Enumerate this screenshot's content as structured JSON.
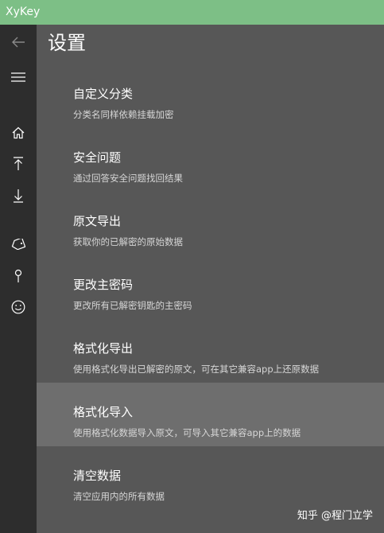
{
  "window": {
    "title": "XyKey"
  },
  "sidebar": {
    "buttons": [
      {
        "name": "back",
        "icon": "back-arrow-icon"
      },
      {
        "name": "menu",
        "icon": "hamburger-menu-icon"
      },
      {
        "name": "home",
        "icon": "home-icon"
      },
      {
        "name": "upload",
        "icon": "upload-icon"
      },
      {
        "name": "download",
        "icon": "download-icon"
      },
      {
        "name": "tag",
        "icon": "tag-icon"
      },
      {
        "name": "pin",
        "icon": "pin-icon"
      },
      {
        "name": "smile",
        "icon": "smiley-icon"
      }
    ]
  },
  "main": {
    "page_title": "设置",
    "items": [
      {
        "title": "自定义分类",
        "desc": "分类名同样依赖挂载加密"
      },
      {
        "title": "安全问题",
        "desc": "通过回答安全问题找回结果"
      },
      {
        "title": "原文导出",
        "desc": "获取你的已解密的原始数据"
      },
      {
        "title": "更改主密码",
        "desc": "更改所有已解密钥匙的主密码"
      },
      {
        "title": "格式化导出",
        "desc": "使用格式化导出已解密的原文，可在其它兼容app上还原数据"
      },
      {
        "title": "格式化导入",
        "desc": "使用格式化数据导入原文，可导入其它兼容app上的数据",
        "highlighted": true
      },
      {
        "title": "清空数据",
        "desc": "清空应用内的所有数据"
      }
    ]
  },
  "watermark": {
    "text": "知乎 @程门立学"
  },
  "colors": {
    "titlebar": "#7dbf86",
    "sidebar": "#2d2d2d",
    "main": "#575757",
    "highlight": "#6e6e6e"
  }
}
